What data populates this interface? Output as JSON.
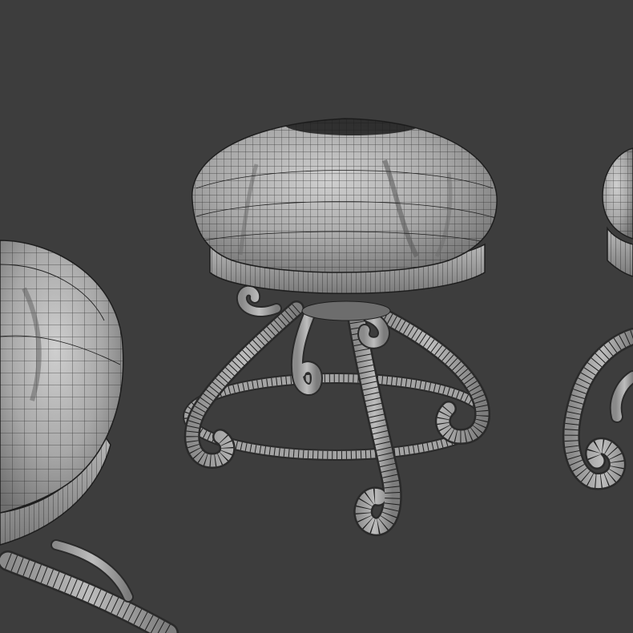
{
  "viewport": {
    "background": "#3d3d3d"
  },
  "scene": {
    "shading": "solid-with-wireframe",
    "object_kind": "wrought-iron stool with tufted cushion",
    "object_count": 3
  },
  "colors": {
    "surface": "#9c9c9c",
    "surface_light": "#c7c7c7",
    "surface_dark": "#6a6a6a",
    "wire": "#1e1e1e",
    "shadow": "#2f2f2f"
  }
}
